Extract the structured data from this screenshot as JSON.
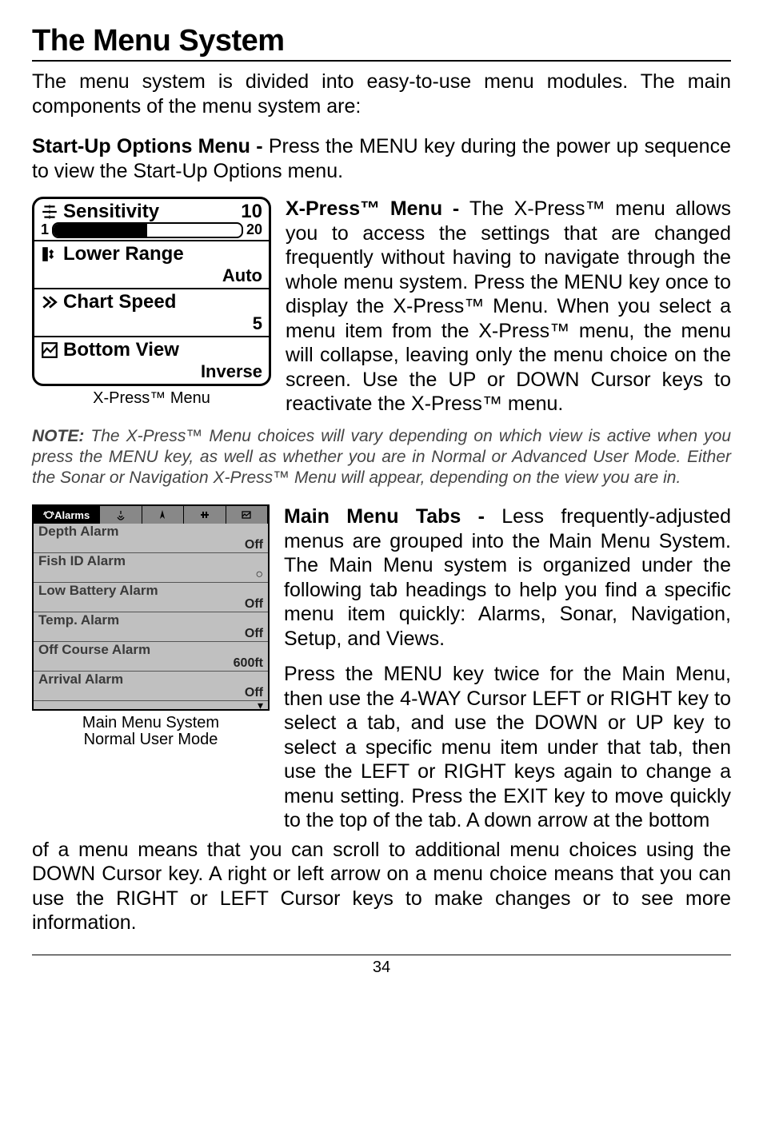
{
  "title": "The Menu System",
  "intro": "The menu system is divided into easy-to-use menu modules. The main components of the menu system are:",
  "startup": {
    "label": "Start-Up Options Menu - ",
    "text": "Press the MENU key during the power up sequence to view the Start-Up Options menu."
  },
  "xpress": {
    "label": "X-Press™ Menu - ",
    "text": "The X-Press™ menu allows you to access the settings that are changed frequently without having to navigate through the whole menu system. Press the MENU key once to display the X-Press™ Menu. When you select a menu item from the X-Press™ menu, the menu will collapse, leaving only the menu choice on the screen. Use the UP or DOWN Cursor keys to reactivate the X-Press™ menu.",
    "caption": "X-Press™ Menu",
    "items": {
      "sensitivity": {
        "label": "Sensitivity",
        "value": "10",
        "min": "1",
        "max": "20"
      },
      "lower_range": {
        "label": "Lower Range",
        "value": "Auto"
      },
      "chart_speed": {
        "label": "Chart Speed",
        "value": "5"
      },
      "bottom_view": {
        "label": "Bottom View",
        "value": "Inverse"
      }
    }
  },
  "note": {
    "label": "NOTE: ",
    "text": "The X-Press™ Menu choices will vary depending on which view is active when you press the MENU key, as well as whether you are in Normal or Advanced User Mode. Either the Sonar or Navigation X-Press™ Menu will appear, depending on the view you are in."
  },
  "mainmenu": {
    "label": "Main Menu Tabs - ",
    "text1": "Less frequently-adjusted menus are grouped into the Main Menu System. The Main Menu system is organized under the following tab headings to help you find a specific menu item quickly: Alarms, Sonar, Navigation, Setup, and Views.",
    "text2": "Press the MENU key twice for the Main Menu, then use the 4-WAY Cursor LEFT or RIGHT key to select a tab, and use the DOWN or UP key to select a specific menu item under that tab, then use the LEFT or RIGHT keys again to change a menu setting. Press the EXIT key to move quickly to the top of the tab. A down arrow at the bottom",
    "text3": "of a menu means that you can scroll to additional menu choices using the DOWN Cursor key. A right or left arrow on a menu choice means that you can use the RIGHT or LEFT Cursor keys to make changes or to see more information.",
    "caption1": "Main Menu System",
    "caption2": "Normal User Mode",
    "tab_active": "Alarms",
    "items": {
      "depth": {
        "label": "Depth Alarm",
        "value": "Off"
      },
      "fishid": {
        "label": "Fish ID Alarm",
        "value": "○"
      },
      "lowbat": {
        "label": "Low Battery Alarm",
        "value": "Off"
      },
      "temp": {
        "label": "Temp. Alarm",
        "value": "Off"
      },
      "offcourse": {
        "label": "Off Course Alarm",
        "value": "600ft"
      },
      "arrival": {
        "label": "Arrival Alarm",
        "value": "Off"
      }
    }
  },
  "page": "34"
}
